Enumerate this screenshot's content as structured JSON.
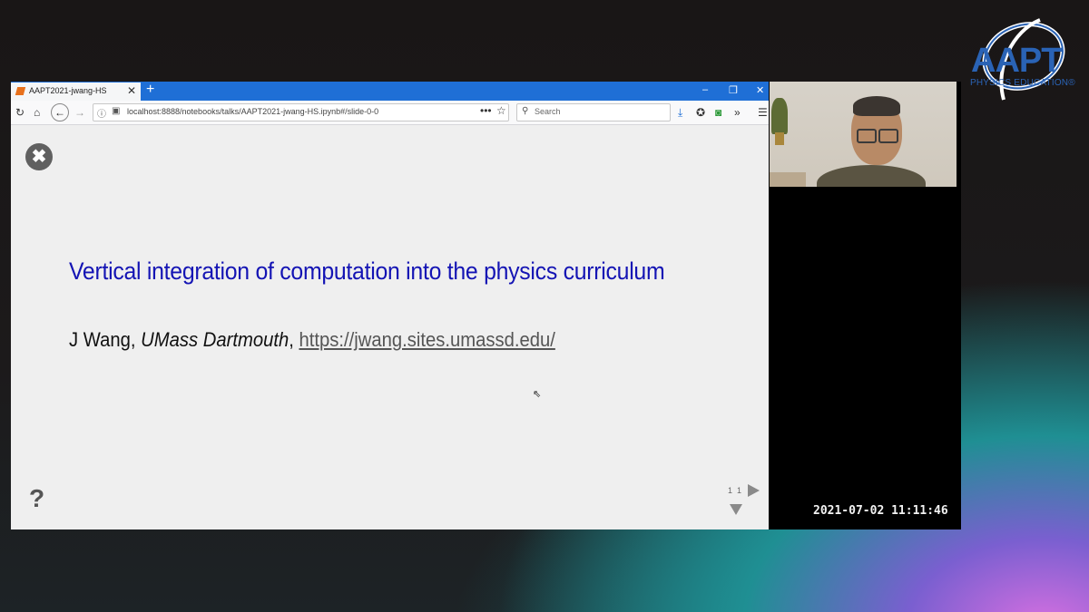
{
  "logo": {
    "text": "AAPT",
    "subtitle": "PHYSICS EDUCATION®",
    "color": "#2a63b5"
  },
  "browser": {
    "tab_title": "AAPT2021-jwang-HS",
    "tab_close": "✕",
    "new_tab": "+",
    "window_buttons": {
      "minimize": "–",
      "restore": "❐",
      "close": "✕"
    },
    "url": "localhost:8888/notebooks/talks/AAPT2021-jwang-HS.ipynb#/slide-0-0",
    "search_placeholder": "Search",
    "accent": "#1f6fd6"
  },
  "slide": {
    "title": "Vertical integration of computation into the physics curriculum",
    "author": "J Wang",
    "separator1": ", ",
    "affiliation": "UMass Dartmouth",
    "separator2": ", ",
    "link": "https://jwang.sites.umassd.edu/",
    "help": "?",
    "close_symbol": "✖",
    "pager_left": "1",
    "pager_right": "1",
    "title_color": "#1414b4"
  },
  "video": {
    "timestamp": "2021-07-02  11:11:46"
  }
}
